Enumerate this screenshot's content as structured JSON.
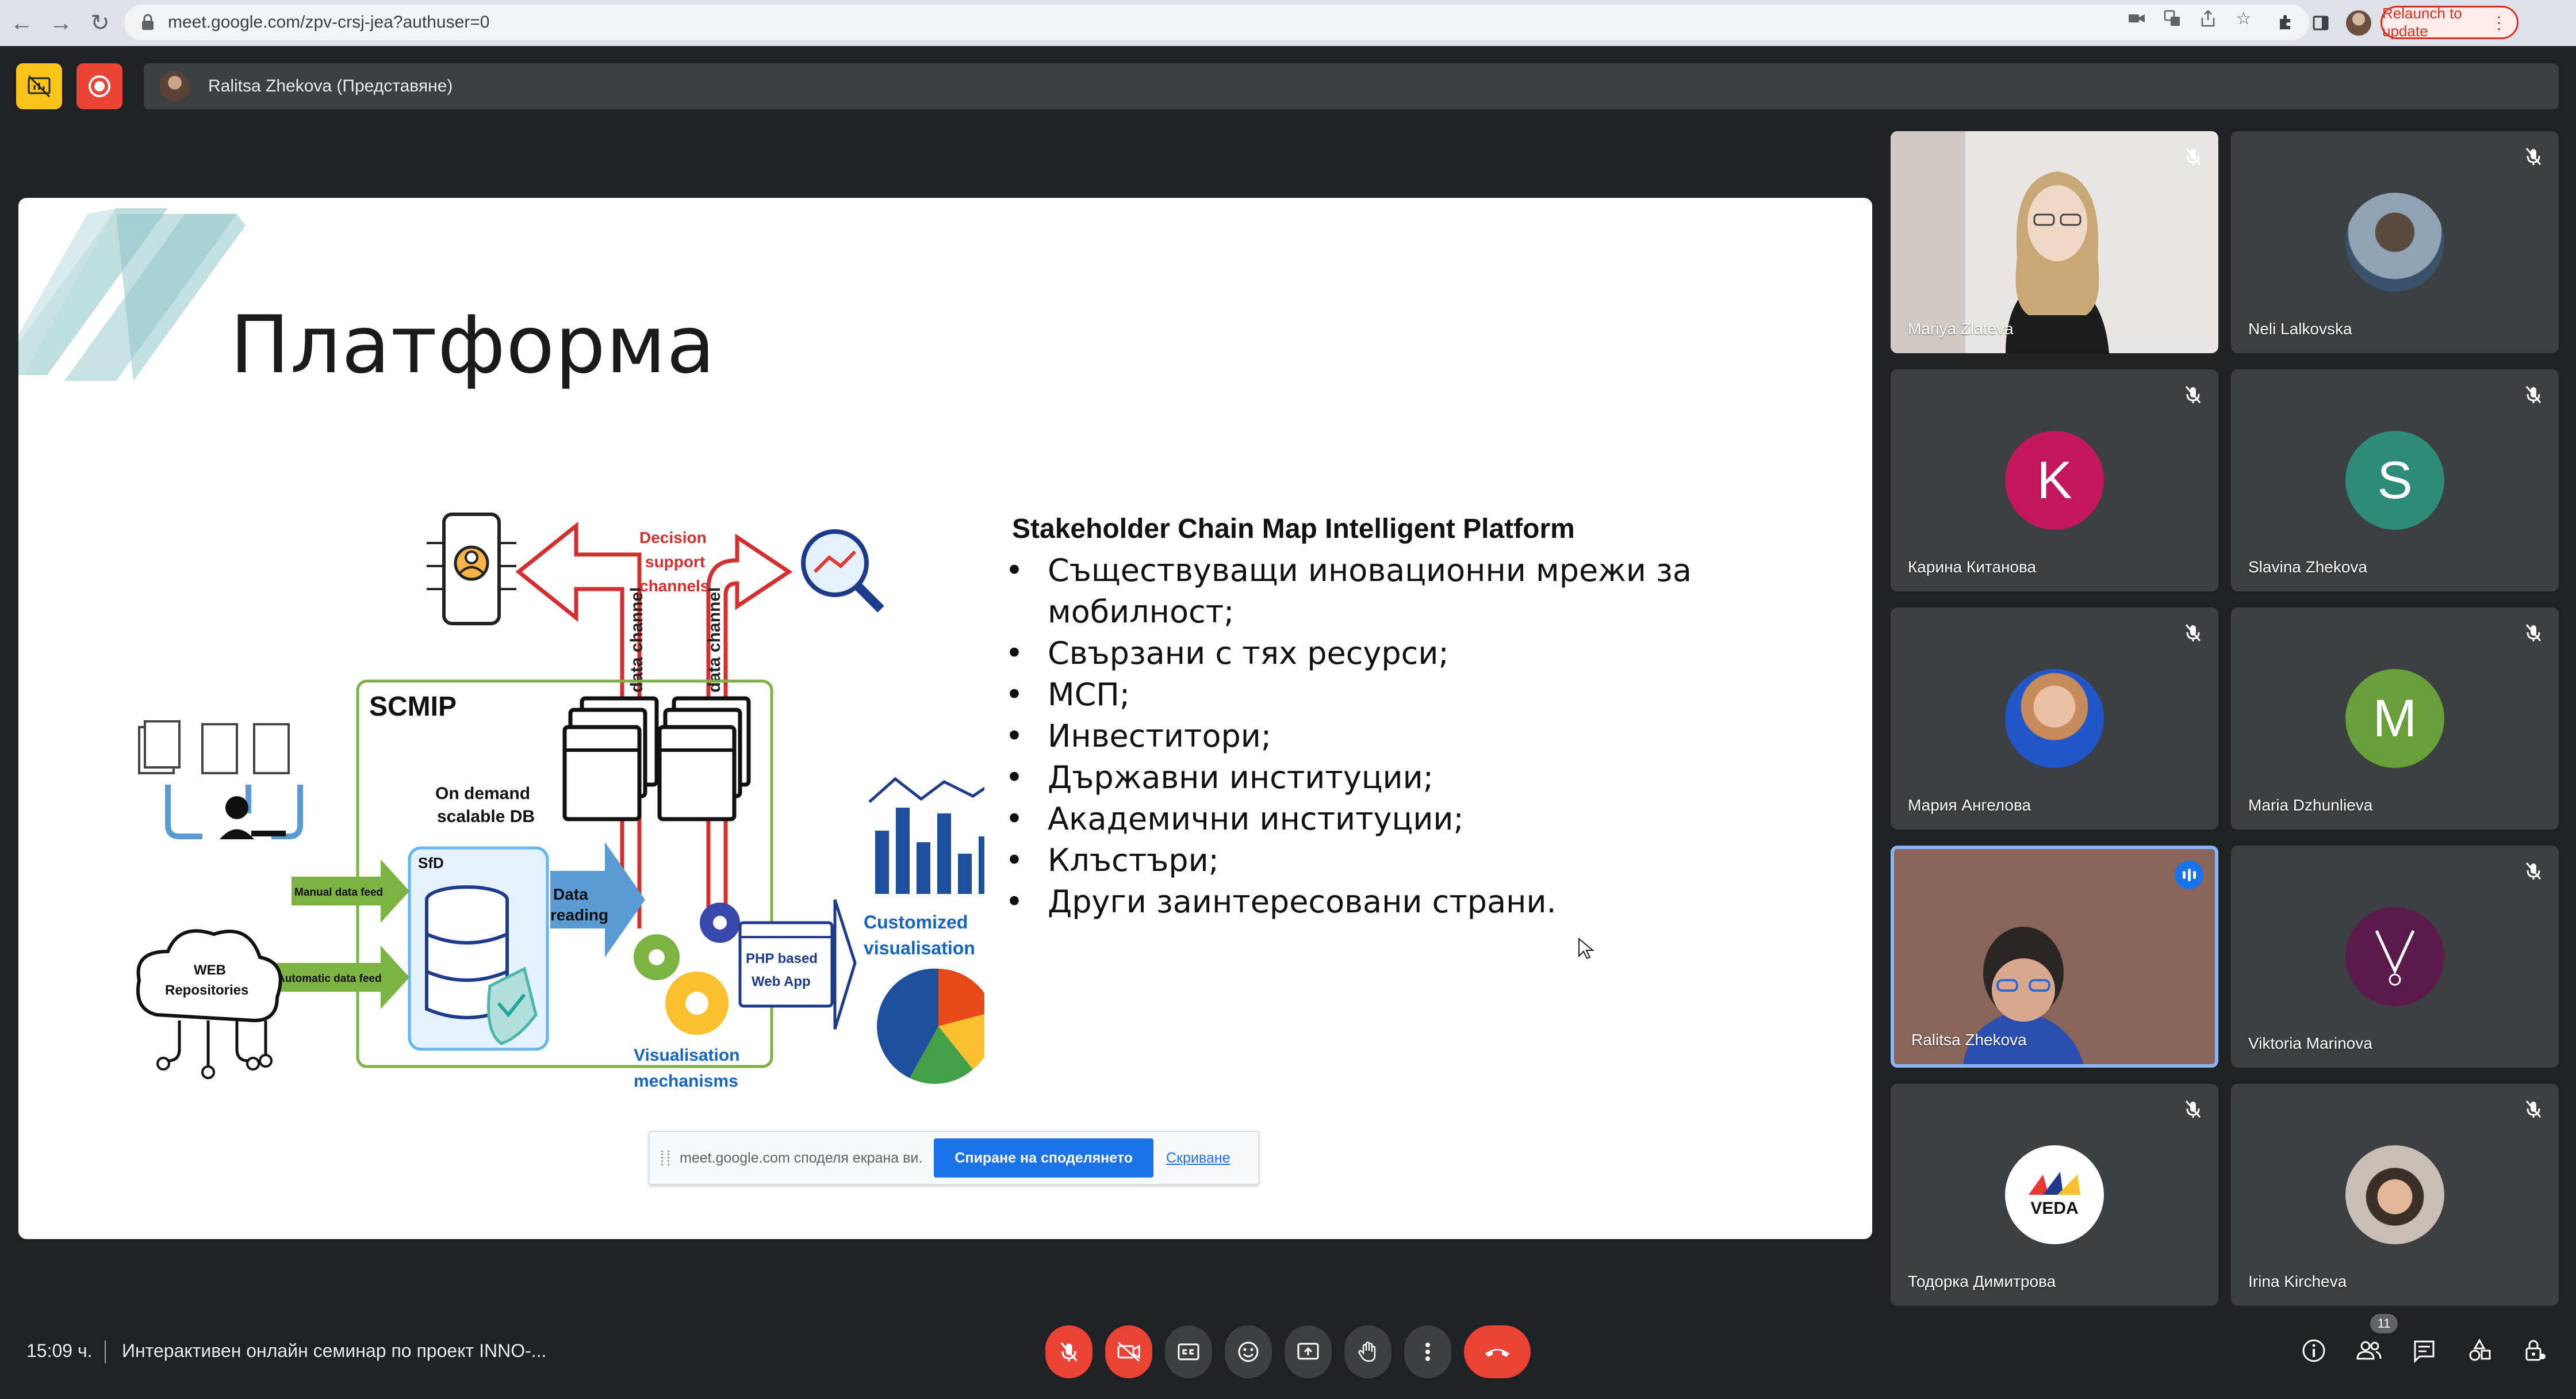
{
  "browser": {
    "url": "meet.google.com/zpv-crsj-jea?authuser=0",
    "relaunch_label": "Relaunch to update"
  },
  "topbar": {
    "presenter_text": "Ralitsa Zhekova (Представяне)"
  },
  "slide": {
    "title": "Платформа",
    "heading": "Stakeholder Chain Map Intelligent Platform",
    "bullets": [
      "Съществуващи иновационни мрежи за мобилност;",
      "Свързани с тях ресурси;",
      "МСП;",
      "Инвеститори;",
      "Държавни институции;",
      "Академични институции;",
      "Клъстъри;",
      "Други заинтересовани страни."
    ],
    "diagram": {
      "decision_label": [
        "Decision",
        "support",
        "channels"
      ],
      "data_channel": "data channel",
      "scmip": "SCMIP",
      "on_demand": [
        "On demand",
        "scalable DB"
      ],
      "sfd": "SfD",
      "data_reading": [
        "Data",
        "reading"
      ],
      "php": [
        "PHP based",
        "Web App"
      ],
      "customized": [
        "Customized",
        "visualisation"
      ],
      "vis_mech": [
        "Visualisation",
        "mechanisms"
      ],
      "manual_feed": "Manual data feed",
      "auto_feed": "Automatic data feed",
      "web_repos": [
        "WEB",
        "Repositories"
      ]
    },
    "share_banner": {
      "text": "meet.google.com споделя екрана ви.",
      "stop_label": "Спиране на споделянето",
      "hide_label": "Скриване"
    }
  },
  "participants": [
    {
      "name": "Mariya Zlateva",
      "type": "video",
      "muted": true
    },
    {
      "name": "Neli Lalkovska",
      "type": "photo",
      "muted": true
    },
    {
      "name": "Карина Китанова",
      "type": "letter",
      "letter": "K",
      "color": "#c2185b",
      "muted": true
    },
    {
      "name": "Slavina Zhekova",
      "type": "letter",
      "letter": "S",
      "color": "#2e8b78",
      "muted": true
    },
    {
      "name": "Мария Ангелова",
      "type": "photo",
      "muted": true
    },
    {
      "name": "Maria Dzhunlieva",
      "type": "letter",
      "letter": "M",
      "color": "#689f38",
      "muted": true
    },
    {
      "name": "Ralitsa Zhekova",
      "type": "video",
      "muted": false,
      "speaking": true
    },
    {
      "name": "Viktoria Marinova",
      "type": "logo",
      "muted": true
    },
    {
      "name": "Тодорка Димитрова",
      "type": "logo",
      "logo_text": "VEDA",
      "muted": true
    },
    {
      "name": "Irina Kircheva",
      "type": "photo",
      "muted": true
    }
  ],
  "bottombar": {
    "time": "15:09 ч.",
    "meeting_name": "Интерактивен онлайн семинар по проект INNO-...",
    "people_count": "11"
  }
}
